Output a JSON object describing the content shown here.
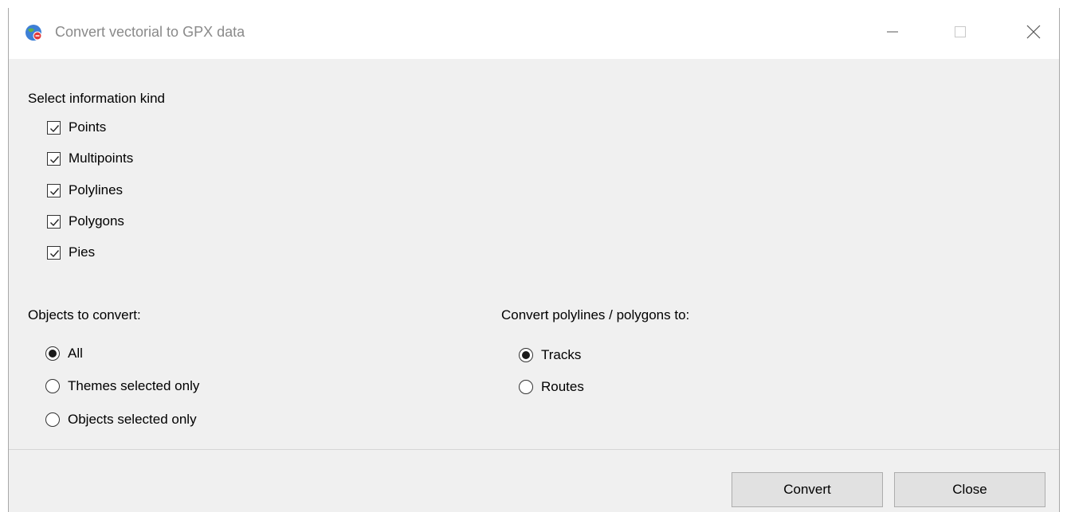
{
  "window": {
    "title": "Convert vectorial to GPX data"
  },
  "info_kind": {
    "heading": "Select information kind",
    "items": [
      {
        "label": "Points",
        "checked": true
      },
      {
        "label": "Multipoints",
        "checked": true
      },
      {
        "label": "Polylines",
        "checked": true
      },
      {
        "label": "Polygons",
        "checked": true
      },
      {
        "label": "Pies",
        "checked": true
      }
    ]
  },
  "objects": {
    "heading": "Objects to convert:",
    "options": [
      {
        "label": "All",
        "selected": true
      },
      {
        "label": "Themes selected only",
        "selected": false
      },
      {
        "label": "Objects selected only",
        "selected": false
      }
    ]
  },
  "convert_to": {
    "heading": "Convert polylines / polygons to:",
    "options": [
      {
        "label": "Tracks",
        "selected": true
      },
      {
        "label": "Routes",
        "selected": false
      }
    ]
  },
  "buttons": {
    "convert": "Convert",
    "close": "Close"
  },
  "icons": {
    "app": "app-globe-icon",
    "minimize": "minimize-icon",
    "maximize": "maximize-icon",
    "close": "close-icon"
  }
}
